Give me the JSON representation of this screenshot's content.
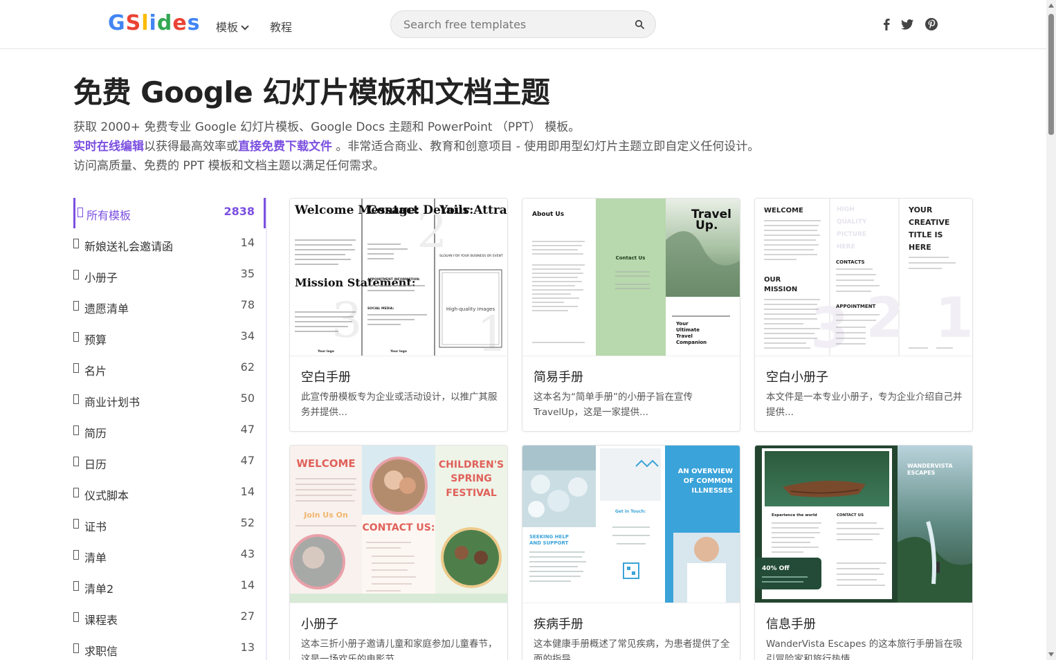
{
  "brand": {
    "logo_letters": [
      "G",
      "S",
      "l",
      "i",
      "d",
      "e",
      "s"
    ],
    "logo_colors": [
      "#4285f4",
      "#ea4335",
      "#fbbc05",
      "#4285f4",
      "#34a853",
      "#ea4335",
      "#4285f4"
    ]
  },
  "nav": {
    "templates": "模板",
    "tutorial": "教程"
  },
  "search": {
    "placeholder": "Search free templates"
  },
  "hero": {
    "title": "免费 Google 幻灯片模板和文档主题",
    "line1": "获取 2000+ 免费专业 Google 幻灯片模板、Google Docs 主题和 PowerPoint （PPT） 模板。",
    "link1": "实时在线编辑",
    "text2": "以获得最高效率或",
    "link2": "直接免费下载文件",
    "text3": " 。非常适合商业、教育和创意项目 - 使用即用型幻灯片主题立即自定义任何设计。访问高质量、免费的 PPT 模板和文档主题以满足任何需求。"
  },
  "categories": [
    {
      "label": "所有模板",
      "count": "2838"
    },
    {
      "label": "新娘送礼会邀请函",
      "count": "14"
    },
    {
      "label": "小册子",
      "count": "35"
    },
    {
      "label": "遗愿清单",
      "count": "78"
    },
    {
      "label": "预算",
      "count": "34"
    },
    {
      "label": "名片",
      "count": "62"
    },
    {
      "label": "商业计划书",
      "count": "50"
    },
    {
      "label": "简历",
      "count": "47"
    },
    {
      "label": "日历",
      "count": "47"
    },
    {
      "label": "仪式脚本",
      "count": "14"
    },
    {
      "label": "证书",
      "count": "52"
    },
    {
      "label": "清单",
      "count": "43"
    },
    {
      "label": "清单2",
      "count": "14"
    },
    {
      "label": "课程表",
      "count": "27"
    },
    {
      "label": "求职信",
      "count": "13"
    }
  ],
  "cards": [
    {
      "title": "空白手册",
      "desc": "此宣传册模板专为企业或活动设计，以推广其服务并提供...",
      "thumb": {
        "col1_h1": "Welcome Message:",
        "col1_h2": "Mission Statement:",
        "col2_h1": "Contact Details:",
        "col2_sub1": "APPOINTMENT INFORMATION:",
        "col2_sub2": "SOCIAL MEDIA:",
        "col3_h1": "Your Attractive Title",
        "col3_slogan": "SLOGAN FOR YOUR BUSINESS OR EVENT",
        "col3_image": "High-quality images",
        "logo": "Your logo"
      }
    },
    {
      "title": "简易手册",
      "desc": "这本名为“简单手册”的小册子旨在宣传 TravelUp，这是一家提供...",
      "thumb": {
        "about": "About Us",
        "contact": "Contact Us",
        "brand": "Travel Up.",
        "tagline": "Your Ultimate Travel Companion"
      }
    },
    {
      "title": "空白小册子",
      "desc": "本文件是一本专业小册子，专为企业介绍自己并提供...",
      "thumb": {
        "welcome": "WELCOME",
        "mission": "OUR MISSION",
        "image": "HIGH QUALITY PICTURE HERE",
        "contacts": "CONTACTS",
        "appointment": "APPOINTMENT",
        "headline": "YOUR CREATIVE TITLE IS HERE"
      }
    },
    {
      "title": "小册子",
      "desc": "这本三折小册子邀请儿童和家庭参加儿童春节，这是一场欢乐的电影节...",
      "thumb": {
        "welcome": "WELCOME",
        "join": "Join Us On",
        "contact": "CONTACT US:",
        "festival": "CHILDREN'S SPRING FESTIVAL"
      }
    },
    {
      "title": "疾病手册",
      "desc": "这本健康手册概述了常见疾病，为患者提供了全面的指导...",
      "thumb": {
        "overview": "AN OVERVIEW OF COMMON ILLNESSES",
        "help": "SEEKING HELP AND SUPPORT",
        "touch": "Get in Touch:"
      }
    },
    {
      "title": "信息手册",
      "desc": "WanderVista Escapes 的这本旅行手册旨在吸引冒险家和旅行热情...",
      "thumb": {
        "brand": "WANDERVISTA ESCAPES",
        "experience": "Experience the world",
        "contact": "CONTACT US",
        "offer": "40% Off"
      }
    }
  ],
  "colors": {
    "accent": "#7b4fe0",
    "text": "#333333",
    "muted": "#555555",
    "border": "#e3e3e3"
  },
  "icons": [
    "chevron-down-icon",
    "search-icon",
    "facebook-icon",
    "twitter-icon",
    "pinterest-icon",
    "checkbox-icon"
  ]
}
